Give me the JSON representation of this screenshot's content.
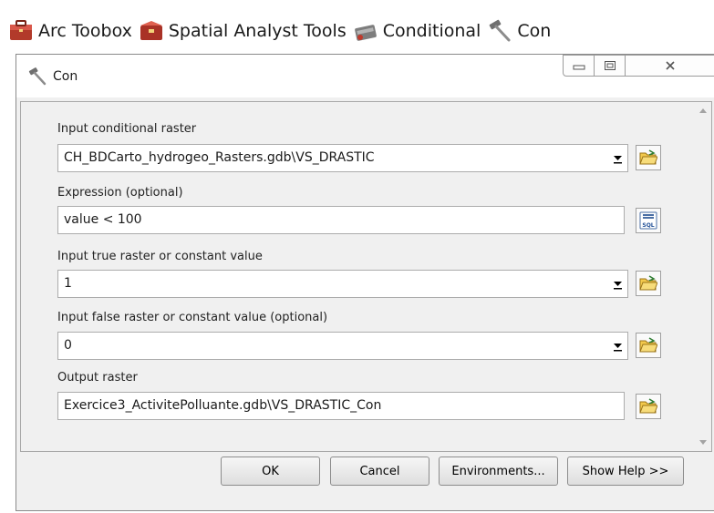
{
  "breadcrumb": {
    "items": [
      {
        "label": "Arc Toobox",
        "icon": "toolbox-icon"
      },
      {
        "label": "Spatial Analyst Tools",
        "icon": "toolbox-icon"
      },
      {
        "label": "Conditional",
        "icon": "toolset-icon"
      },
      {
        "label": "Con",
        "icon": "hammer-icon"
      }
    ]
  },
  "window": {
    "title": "Con",
    "controls": {
      "minimize": "minimize-icon",
      "maximize": "maximize-icon",
      "close": "close-icon"
    }
  },
  "form": {
    "fields": [
      {
        "label": "Input conditional raster",
        "value": "CH_BDCarto_hydrogeo_Rasters.gdb\\VS_DRASTIC",
        "type": "dropdown",
        "button": "browse-folder-icon"
      },
      {
        "label": "Expression (optional)",
        "value": "value < 100",
        "type": "text",
        "button": "sql-icon"
      },
      {
        "label": "Input true raster or constant value",
        "value": "1",
        "type": "dropdown",
        "button": "browse-folder-icon"
      },
      {
        "label": "Input false raster or constant value (optional)",
        "value": "0",
        "type": "dropdown",
        "button": "browse-folder-icon"
      },
      {
        "label": "Output raster",
        "value": "Exercice3_ActivitePolluante.gdb\\VS_DRASTIC_Con",
        "type": "text",
        "button": "browse-folder-icon"
      }
    ],
    "sql_icon_text": "SQL"
  },
  "buttons": {
    "ok": "OK",
    "cancel": "Cancel",
    "environments": "Environments...",
    "show_help": "Show Help >>"
  },
  "colors": {
    "window_bg": "#f0f0f0",
    "field_bg": "#ffffff",
    "folder_yellow": "#f2c94c",
    "toolbox_red": "#c0392b"
  }
}
